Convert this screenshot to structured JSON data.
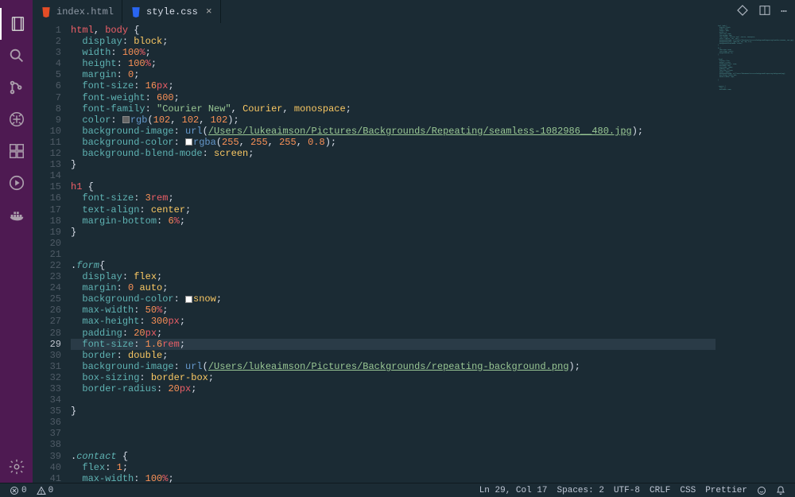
{
  "activity_bar": {
    "gear": "⚙"
  },
  "tabs": [
    {
      "icon_color": "#e44d26",
      "label": "index.html",
      "active": false
    },
    {
      "icon_color": "#2965f1",
      "label": "style.css",
      "active": true
    }
  ],
  "tab_actions": {
    "view_options": "⋯"
  },
  "code_lines": [
    {
      "n": 1,
      "html": "<span class='sel'>html</span><span class='col'>, </span><span class='sel'>body</span> <span class='br'>{</span>"
    },
    {
      "n": 2,
      "html": "  <span class='prop'>display</span><span class='col'>: </span><span class='val'>block</span><span class='col'>;</span>"
    },
    {
      "n": 3,
      "html": "  <span class='prop'>width</span><span class='col'>: </span><span class='num'>100</span><span class='unit'>%</span><span class='col'>;</span>"
    },
    {
      "n": 4,
      "html": "  <span class='prop'>height</span><span class='col'>: </span><span class='num'>100</span><span class='unit'>%</span><span class='col'>;</span>"
    },
    {
      "n": 5,
      "html": "  <span class='prop'>margin</span><span class='col'>: </span><span class='num'>0</span><span class='col'>;</span>"
    },
    {
      "n": 6,
      "html": "  <span class='prop'>font-size</span><span class='col'>: </span><span class='num'>16</span><span class='unit'>px</span><span class='col'>;</span>"
    },
    {
      "n": 7,
      "html": "  <span class='prop'>font-weight</span><span class='col'>: </span><span class='num'>600</span><span class='col'>;</span>"
    },
    {
      "n": 8,
      "html": "  <span class='prop'>font-family</span><span class='col'>: </span><span class='str'>\"Courier New\"</span><span class='col'>, </span><span class='val'>Courier</span><span class='col'>, </span><span class='val'>monospace</span><span class='col'>;</span>"
    },
    {
      "n": 9,
      "html": "  <span class='prop'>color</span><span class='col'>: </span><span class='swatch'></span><span class='fn'>rgb</span><span class='col'>(</span><span class='num'>102</span><span class='col'>, </span><span class='num'>102</span><span class='col'>, </span><span class='num'>102</span><span class='col'>);</span>"
    },
    {
      "n": 10,
      "html": "  <span class='prop'>background-image</span><span class='col'>: </span><span class='fn'>url</span><span class='col'>(</span><span class='url'>/Users/lukeaimson/Pictures/Backgrounds/Repeating/seamless-1082986__480.jpg</span><span class='col'>);</span>"
    },
    {
      "n": 11,
      "html": "  <span class='prop'>background-color</span><span class='col'>: </span><span class='swatch white'></span><span class='fn'>rgba</span><span class='col'>(</span><span class='num'>255</span><span class='col'>, </span><span class='num'>255</span><span class='col'>, </span><span class='num'>255</span><span class='col'>, </span><span class='num'>0.8</span><span class='col'>);</span>"
    },
    {
      "n": 12,
      "html": "  <span class='prop'>background-blend-mode</span><span class='col'>: </span><span class='val'>screen</span><span class='col'>;</span>"
    },
    {
      "n": 13,
      "html": "<span class='br'>}</span>"
    },
    {
      "n": 14,
      "html": ""
    },
    {
      "n": 15,
      "html": "<span class='sel'>h1</span> <span class='br'>{</span>"
    },
    {
      "n": 16,
      "html": "  <span class='prop'>font-size</span><span class='col'>: </span><span class='num'>3</span><span class='unit'>rem</span><span class='col'>;</span>"
    },
    {
      "n": 17,
      "html": "  <span class='prop'>text-align</span><span class='col'>: </span><span class='val'>center</span><span class='col'>;</span>"
    },
    {
      "n": 18,
      "html": "  <span class='prop'>margin-bottom</span><span class='col'>: </span><span class='num'>6</span><span class='unit'>%</span><span class='col'>;</span>"
    },
    {
      "n": 19,
      "html": "<span class='br'>}</span>"
    },
    {
      "n": 20,
      "html": ""
    },
    {
      "n": 21,
      "html": ""
    },
    {
      "n": 22,
      "html": "<span class='col'>.</span><span class='cls'>form</span><span class='br'>{</span>"
    },
    {
      "n": 23,
      "html": "  <span class='prop'>display</span><span class='col'>: </span><span class='val'>flex</span><span class='col'>;</span>"
    },
    {
      "n": 24,
      "html": "  <span class='prop'>margin</span><span class='col'>: </span><span class='num'>0</span> <span class='val'>auto</span><span class='col'>;</span>"
    },
    {
      "n": 25,
      "html": "  <span class='prop'>background-color</span><span class='col'>: </span><span class='swatch white'></span><span class='val'>snow</span><span class='col'>;</span>"
    },
    {
      "n": 26,
      "html": "  <span class='prop'>max-width</span><span class='col'>: </span><span class='num'>50</span><span class='unit'>%</span><span class='col'>;</span>"
    },
    {
      "n": 27,
      "html": "  <span class='prop'>max-height</span><span class='col'>: </span><span class='num'>300</span><span class='unit'>px</span><span class='col'>;</span>"
    },
    {
      "n": 28,
      "html": "  <span class='prop'>padding</span><span class='col'>: </span><span class='num'>20</span><span class='unit'>px</span><span class='col'>;</span>"
    },
    {
      "n": 29,
      "hl": true,
      "html": "  <span class='prop'>font-size</span><span class='col'>: </span><span class='num'>1.6</span><span class='unit'>rem</span><span class='col'>;</span>"
    },
    {
      "n": 30,
      "html": "  <span class='prop'>border</span><span class='col'>: </span><span class='val'>double</span><span class='col'>;</span>"
    },
    {
      "n": 31,
      "html": "  <span class='prop'>background-image</span><span class='col'>: </span><span class='fn'>url</span><span class='col'>(</span><span class='url'>/Users/lukeaimson/Pictures/Backgrounds/repeating-background.png</span><span class='col'>);</span>"
    },
    {
      "n": 32,
      "html": "  <span class='prop'>box-sizing</span><span class='col'>: </span><span class='val'>border-box</span><span class='col'>;</span>"
    },
    {
      "n": 33,
      "html": "  <span class='prop'>border-radius</span><span class='col'>: </span><span class='num'>20</span><span class='unit'>px</span><span class='col'>;</span>"
    },
    {
      "n": 34,
      "html": ""
    },
    {
      "n": 35,
      "html": "<span class='br'>}</span>"
    },
    {
      "n": 36,
      "html": ""
    },
    {
      "n": 37,
      "html": ""
    },
    {
      "n": 38,
      "html": ""
    },
    {
      "n": 39,
      "html": "<span class='col'>.</span><span class='cls'>contact</span> <span class='br'>{</span>"
    },
    {
      "n": 40,
      "html": "  <span class='prop'>flex</span><span class='col'>: </span><span class='num'>1</span><span class='col'>;</span>"
    },
    {
      "n": 41,
      "html": "  <span class='prop'>max-width</span><span class='col'>: </span><span class='num'>100</span><span class='unit'>%</span><span class='col'>;</span>"
    }
  ],
  "status_bar": {
    "errors": "0",
    "warnings": "0",
    "pos": "Ln 29, Col 17",
    "spaces": "Spaces: 2",
    "encoding": "UTF-8",
    "eol": "CRLF",
    "lang": "CSS",
    "prettier": "Prettier"
  }
}
